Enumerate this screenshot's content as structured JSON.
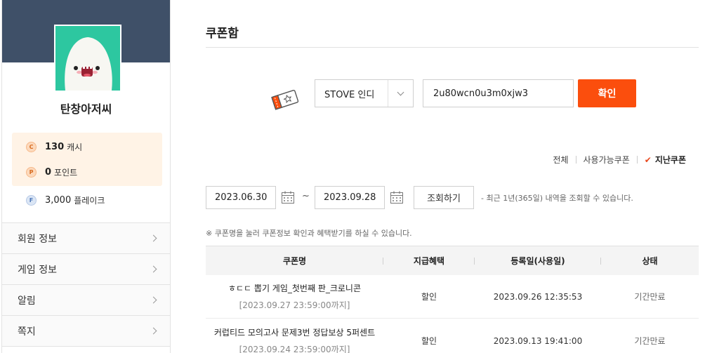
{
  "sidebar": {
    "username": "탄창아저씨",
    "points": [
      {
        "coin": "C",
        "value": "130",
        "unit": "캐시"
      },
      {
        "coin": "P",
        "value": "0",
        "unit": "포인트"
      },
      {
        "coin": "F",
        "value": "3,000",
        "unit": "플레이크"
      }
    ],
    "menu": [
      {
        "label": "회원 정보"
      },
      {
        "label": "게임 정보"
      },
      {
        "label": "알림"
      },
      {
        "label": "쪽지"
      }
    ]
  },
  "main": {
    "title": "쿠폰함",
    "register": {
      "platform_selected": "STOVE 인디",
      "coupon_code": "2u80wcn0u3m0xjw3",
      "confirm_label": "확인"
    },
    "filters": [
      {
        "label": "전체",
        "active": false
      },
      {
        "label": "사용가능쿠폰",
        "active": false
      },
      {
        "label": "지난쿠폰",
        "active": true
      }
    ],
    "search": {
      "start_date": "2023.06.30",
      "end_date": "2023.09.28",
      "tilde": "~",
      "button_label": "조회하기",
      "range_note": "- 최근 1년(365일) 내역을 조회할 수 있습니다."
    },
    "coupon_note": "※ 쿠폰명을 눌러 쿠폰정보 확인과 혜택받기를 하실 수 있습니다.",
    "table": {
      "headers": [
        "쿠폰명",
        "지급혜택",
        "등록일(사용일)",
        "상태"
      ],
      "rows": [
        {
          "name": "ㅎㄷㄷ 뽑기 게임_첫번째 판_크로니콘",
          "expires": "[2023.09.27 23:59:00까지]",
          "benefit": "할인",
          "registered": "2023.09.26 12:35:53",
          "status": "기간만료"
        },
        {
          "name": "커럽티드 모의고사 문제3번 정답보상 5퍼센트",
          "expires": "[2023.09.24 23:59:00까지]",
          "benefit": "할인",
          "registered": "2023.09.13 19:41:00",
          "status": "기간만료"
        }
      ]
    }
  },
  "colors": {
    "accent": "#fb4e0d",
    "banner": "#3f5068",
    "avatar_bg": "#2dc7a0",
    "points_bg": "#fff3e6"
  }
}
